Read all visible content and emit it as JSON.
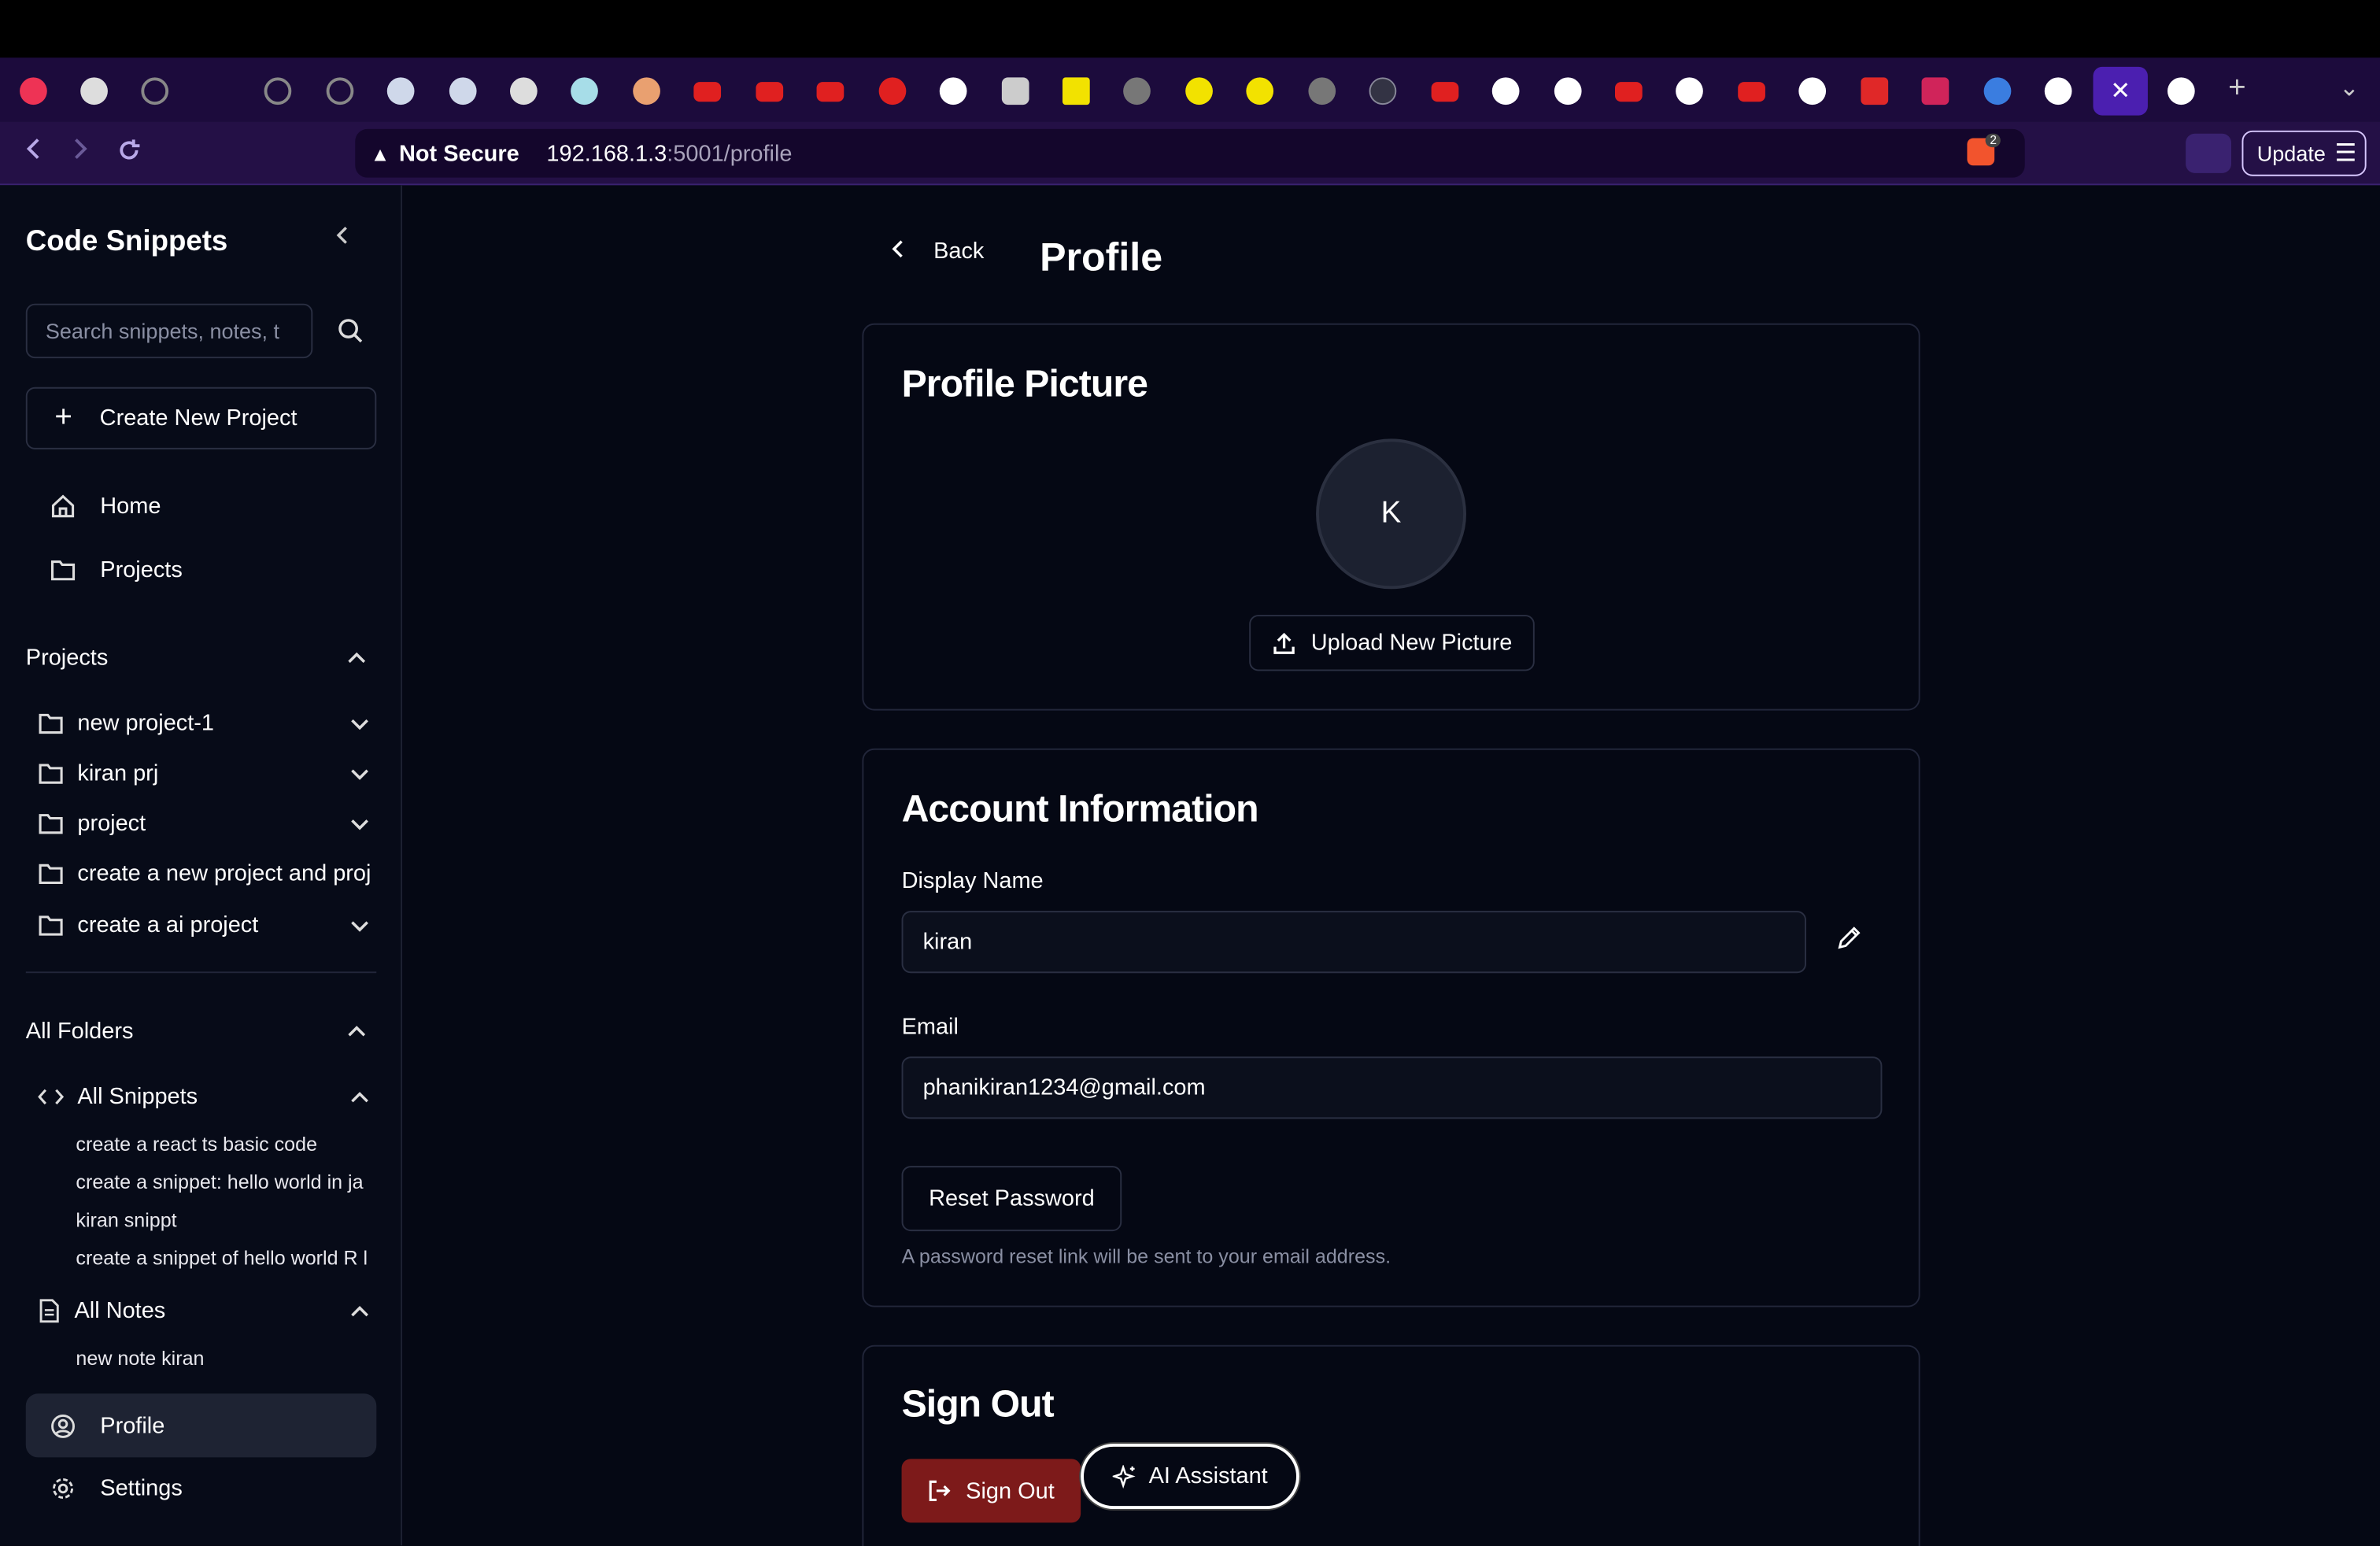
{
  "browser": {
    "not_secure": "Not Secure",
    "url_host": "192.168.1.3",
    "url_path": ":5001/profile",
    "shield_count": "2",
    "update_label": "Update",
    "active_tab_close": "✕",
    "new_tab": "+",
    "tab_menu": "⌄"
  },
  "sidebar": {
    "title": "Code Snippets",
    "search_placeholder": "Search snippets, notes, t",
    "create_label": "Create New Project",
    "nav": {
      "home": "Home",
      "projects": "Projects"
    },
    "projects_heading": "Projects",
    "projects": [
      "new project-1",
      "kiran prj",
      "project",
      "create a new project and proj",
      "create a ai project"
    ],
    "all_folders_heading": "All Folders",
    "all_snippets_label": "All Snippets",
    "snippets": [
      "create a react ts basic code",
      "create a snippet: hello world in ja",
      "kiran snippt",
      "create a snippet of hello world R l"
    ],
    "all_notes_label": "All Notes",
    "notes": [
      "new note kiran"
    ],
    "profile_label": "Profile",
    "settings_label": "Settings"
  },
  "main": {
    "back_label": "Back",
    "title": "Profile",
    "picture_card": {
      "title": "Profile Picture",
      "avatar_initial": "K",
      "upload_label": "Upload New Picture"
    },
    "account_card": {
      "title": "Account Information",
      "display_name_label": "Display Name",
      "display_name_value": "kiran",
      "email_label": "Email",
      "email_value": "phanikiran1234@gmail.com",
      "reset_label": "Reset Password",
      "reset_hint": "A password reset link will be sent to your email address."
    },
    "signout_card": {
      "title": "Sign Out",
      "button_label": "Sign Out"
    },
    "ai_assistant_label": "AI Assistant"
  }
}
